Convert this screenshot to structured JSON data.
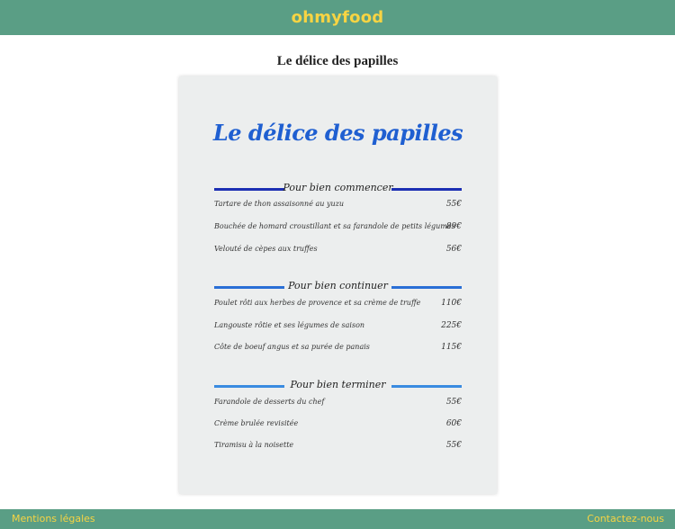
{
  "header": {
    "brand": "ohmyfood"
  },
  "page_title": "Le délice des papilles",
  "menu": {
    "title": "Le délice des papilles",
    "sections": [
      {
        "name": "Pour bien commencer",
        "line_color": "#1c2fb3",
        "items": [
          {
            "dish": "Tartare de thon assaisonné au yuzu",
            "price": "55€"
          },
          {
            "dish": "Bouchée de homard croustillant et sa farandole de petits légumes",
            "price": "89€"
          },
          {
            "dish": "Velouté de cèpes aux truffes",
            "price": "56€"
          }
        ]
      },
      {
        "name": "Pour bien continuer",
        "line_color": "#2a6fd6",
        "items": [
          {
            "dish": "Poulet rôti aux herbes de provence et sa crème de truffe",
            "price": "110€"
          },
          {
            "dish": "Langouste rôtie et ses légumes de saison",
            "price": "225€"
          },
          {
            "dish": "Côte de boeuf angus et sa purée de panais",
            "price": "115€"
          }
        ]
      },
      {
        "name": "Pour bien terminer",
        "line_color": "#3a8be0",
        "items": [
          {
            "dish": "Farandole de desserts du chef",
            "price": "55€"
          },
          {
            "dish": "Crème brulée revisitée",
            "price": "60€"
          },
          {
            "dish": "Tiramisu à la noisette",
            "price": "55€"
          }
        ]
      }
    ]
  },
  "footer": {
    "legal": "Mentions légales",
    "contact": "Contactez-nous"
  },
  "colors": {
    "header_bg": "#5a9e85",
    "brand": "#f7d443",
    "title_blue": "#1f5fd1",
    "card_bg": "#eceeee"
  }
}
